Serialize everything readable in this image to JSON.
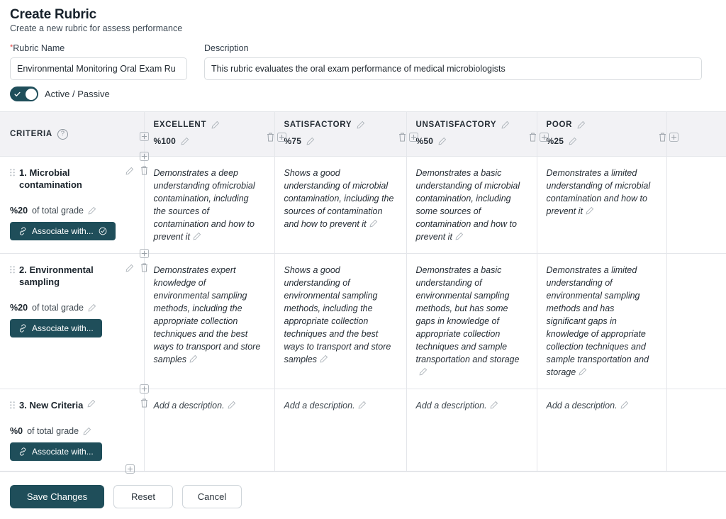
{
  "header": {
    "title": "Create Rubric",
    "subtitle": "Create a new rubric for assess performance"
  },
  "form": {
    "name_label": "Rubric Name",
    "name_required_mark": "*",
    "name_value": "Environmental Monitoring Oral Exam Ru",
    "name_placeholder": "Rubric Name",
    "description_label": "Description",
    "description_value": "This rubric evaluates the oral exam performance of medical microbiologists",
    "description_placeholder": "Description",
    "toggle_label": "Active / Passive",
    "toggle_state": "on"
  },
  "table": {
    "criteria_header": "CRITERIA",
    "criteria_help_icon": "question-circle-icon",
    "levels": [
      {
        "name": "EXCELLENT",
        "percent": "%100"
      },
      {
        "name": "SATISFACTORY",
        "percent": "%75"
      },
      {
        "name": "UNSATISFACTORY",
        "percent": "%50"
      },
      {
        "name": "POOR",
        "percent": "%25"
      }
    ],
    "rows": [
      {
        "number": "1.",
        "name": "Microbial contamination",
        "weight": "%20",
        "weight_suffix": "of total grade",
        "associate_label": "Associate with...",
        "associated": true,
        "cells": [
          "Demonstrates a deep understanding ofmicrobial contamination, including the sources of contamination and how to prevent it",
          "Shows a good understanding of microbial contamination, including the sources of contamination and how to prevent it",
          "Demonstrates a basic understanding of microbial contamination, including some sources of contamination and how to prevent it",
          "Demonstrates a limited understanding of microbial contamination and how to prevent it"
        ]
      },
      {
        "number": "2.",
        "name": "Environmental sampling",
        "weight": "%20",
        "weight_suffix": "of total grade",
        "associate_label": "Associate with...",
        "associated": false,
        "cells": [
          "Demonstrates expert knowledge of environmental sampling methods, including the appropriate collection techniques and the best ways to transport and store samples",
          "Shows a good understanding of environmental sampling methods, including the appropriate collection techniques and the best ways to transport and store samples",
          "Demonstrates a basic understanding of environmental sampling methods, but has some gaps in knowledge of appropriate collection techniques and sample transportation and storage",
          "Demonstrates a limited understanding of environmental sampling methods and has significant gaps in knowledge of appropriate collection techniques and sample transportation and storage"
        ]
      },
      {
        "number": "3.",
        "name": "New Criteria",
        "weight": "%0",
        "weight_suffix": "of total grade",
        "associate_label": "Associate with...",
        "associated": false,
        "cells": [
          "Add a description.",
          "Add a description.",
          "Add a description.",
          "Add a description."
        ]
      }
    ]
  },
  "footer": {
    "save_label": "Save Changes",
    "reset_label": "Reset",
    "cancel_label": "Cancel"
  },
  "colors": {
    "accent": "#1f4e5a",
    "header_bg": "#f2f2f5",
    "border": "#e4e6ea",
    "required": "#e04545"
  }
}
